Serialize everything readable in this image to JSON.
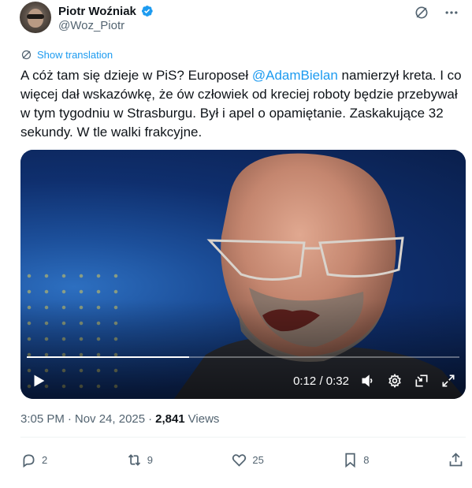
{
  "author": {
    "display_name": "Piotr Woźniak",
    "handle": "@Woz_Piotr"
  },
  "header": {
    "icons": [
      "grok-icon",
      "more-icon"
    ]
  },
  "translation": {
    "label": "Show translation"
  },
  "tweet": {
    "text_before_mention": "A cóż tam się dzieje w PiS? Europoseł ",
    "mention": "@AdamBielan",
    "text_after_mention": " namierzył kreta. I co więcej dał wskazówkę, że ów człowiek od kreciej roboty będzie przebywał w tym tygodniu w Strasburgu. Był i apel o opamiętanie. Zaskakujące 32 sekundy. W tle walki frakcyjne."
  },
  "video": {
    "current_time": "0:12",
    "separator": "/",
    "duration": "0:32",
    "progress_fraction": 0.375,
    "controls": [
      "play-icon",
      "volume-icon",
      "settings-icon",
      "pip-icon",
      "fullscreen-icon"
    ]
  },
  "meta": {
    "time": "3:05 PM",
    "dot1": "·",
    "date": "Nov 24, 2025",
    "dot2": "·",
    "views_count": "2,841",
    "views_label": "Views"
  },
  "actions": {
    "replies": "2",
    "reposts": "9",
    "likes": "25",
    "bookmarks": "8"
  },
  "colors": {
    "accent": "#1d9bf0",
    "text": "#0f1419",
    "secondary": "#536471"
  }
}
